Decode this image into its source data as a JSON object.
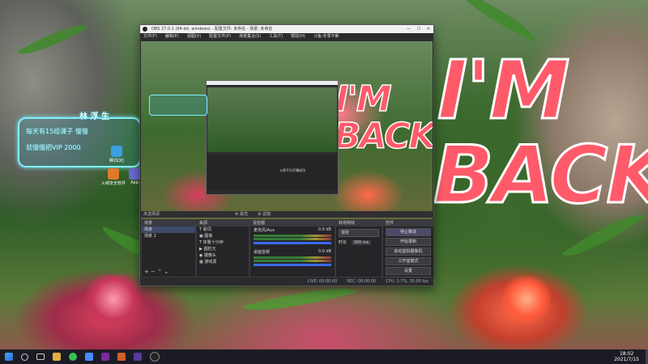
{
  "wallpaper": {
    "text_line1": "I'M",
    "text_line2": "BACK"
  },
  "widget": {
    "title": "林 浮 生",
    "line1": "每天有15组课子  慢慢",
    "line2": "就慢慢把VIP 2000"
  },
  "desktop_icons": [
    {
      "label": "腾讯QQ"
    },
    {
      "label": "火绒安全软件"
    },
    {
      "label": "App"
    }
  ],
  "obs": {
    "title": "OBS 27.0.1 (64-bit, windows) - 配置文件: 未命名 - 场景: 未命名",
    "menu": [
      "文件(F)",
      "编辑(E)",
      "视图(V)",
      "配置文件(P)",
      "场景集合(S)",
      "工具(T)",
      "帮助(H)",
      "斗鱼-冬季不断"
    ],
    "nested_notice": "斗鱼平台开播成功",
    "docks": {
      "scenes": {
        "title": "场景",
        "items": [
          "场景",
          "场景 2"
        ]
      },
      "sources": {
        "title": "来源",
        "items": [
          {
            "name": "歌词",
            "icon": "text-icon"
          },
          {
            "name": "图像",
            "icon": "image-icon"
          },
          {
            "name": "体量十分钟",
            "icon": "text-icon"
          },
          {
            "name": "圆粒元",
            "icon": "play-icon"
          },
          {
            "name": "摄像头",
            "icon": "camera-icon"
          },
          {
            "name": "游戏源",
            "icon": "game-icon"
          }
        ]
      },
      "mixer": {
        "title": "混音器",
        "channels": [
          {
            "name": "麦克风/Aux",
            "db": "0.0 dB"
          },
          {
            "name": "桌面音频",
            "db": "0.0 dB"
          }
        ]
      },
      "transitions": {
        "title": "转场特效",
        "selected": "渐变",
        "duration_label": "时长",
        "duration_value": "300 ms"
      },
      "controls": {
        "title": "控件",
        "buttons": [
          {
            "label": "停止推流",
            "active": true
          },
          {
            "label": "开始录制",
            "active": false
          },
          {
            "label": "启动虚拟摄像机",
            "active": false
          },
          {
            "label": "工作室模式",
            "active": false
          },
          {
            "label": "设置",
            "active": false
          },
          {
            "label": "退出",
            "active": false
          }
        ]
      }
    },
    "scene_header_left": "未选择源",
    "scene_header_mid1": "属性",
    "scene_header_mid2": "滤镜",
    "status": {
      "live": "LIVE: 00:00:00",
      "rec": "REC: 00:00:00",
      "cpu": "CPU: 2.7%, 30.00 fps"
    }
  },
  "taskbar": {
    "time": "18:02",
    "date": "2021/7/15"
  }
}
